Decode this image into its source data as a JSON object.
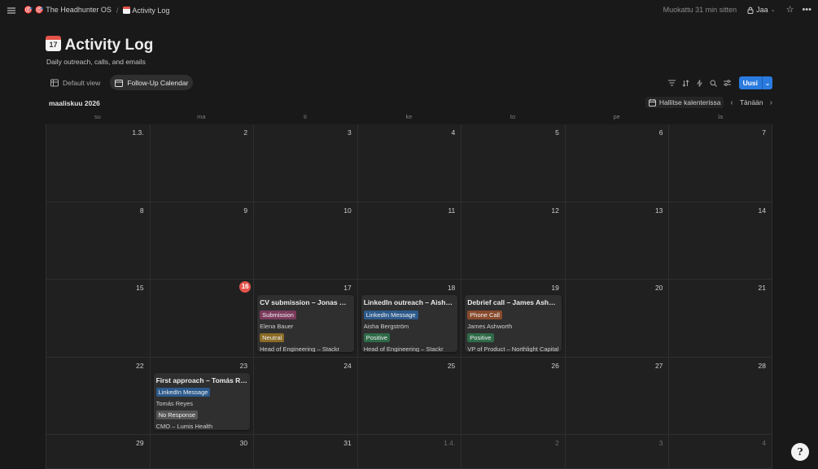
{
  "breadcrumb": {
    "workspace": "The Headhunter OS",
    "page": "Activity Log"
  },
  "header": {
    "edited": "Muokattu 31 min sitten",
    "share": "Jaa"
  },
  "page": {
    "title": "Activity Log",
    "subtitle": "Daily outreach, calls, and emails"
  },
  "views": [
    {
      "label": "Default view",
      "active": false
    },
    {
      "label": "Follow-Up Calendar",
      "active": true
    }
  ],
  "toolbar": {
    "new_label": "Uusi"
  },
  "calendar": {
    "month": "maaliskuu 2026",
    "manage_label": "Hallitse kalenterissa",
    "today_label": "Tänään",
    "weekdays": [
      "su",
      "ma",
      "ti",
      "ke",
      "to",
      "pe",
      "la"
    ],
    "days": [
      {
        "label": "1.3."
      },
      {
        "label": "2"
      },
      {
        "label": "3"
      },
      {
        "label": "4"
      },
      {
        "label": "5"
      },
      {
        "label": "6"
      },
      {
        "label": "7"
      },
      {
        "label": "8"
      },
      {
        "label": "9"
      },
      {
        "label": "10"
      },
      {
        "label": "11"
      },
      {
        "label": "12"
      },
      {
        "label": "13"
      },
      {
        "label": "14"
      },
      {
        "label": "15"
      },
      {
        "label": "16",
        "today": true
      },
      {
        "label": "17",
        "card": {
          "title": "CV submission – Jonas Weber",
          "type": "Submission",
          "type_color": "#7b3a5d",
          "person": "Elena Bauer",
          "outcome": "Neutral",
          "outcome_color": "#8a6a26",
          "role": "Head of Engineering – Stackr"
        }
      },
      {
        "label": "18",
        "card": {
          "title": "LinkedIn outreach – Aisha Bergström",
          "type": "LinkedIn Message",
          "type_color": "#2d5a8c",
          "person": "Aisha Bergström",
          "outcome": "Positive",
          "outcome_color": "#2f6a48",
          "role": "Head of Engineering – Stackr"
        }
      },
      {
        "label": "19",
        "card": {
          "title": "Debrief call – James Ashworth",
          "type": "Phone Call",
          "type_color": "#8a4a2c",
          "person": "James Ashworth",
          "outcome": "Positive",
          "outcome_color": "#2f6a48",
          "role": "VP of Product – Northlight Capital"
        }
      },
      {
        "label": "20"
      },
      {
        "label": "21"
      },
      {
        "label": "22"
      },
      {
        "label": "23",
        "card": {
          "title": "First approach – Tomás Reyes",
          "type": "LinkedIn Message",
          "type_color": "#2d5a8c",
          "person": "Tomás Reyes",
          "outcome": "No Response",
          "outcome_color": "#555555",
          "role": "CMO – Lumis Health"
        }
      },
      {
        "label": "24"
      },
      {
        "label": "25"
      },
      {
        "label": "26"
      },
      {
        "label": "27"
      },
      {
        "label": "28"
      },
      {
        "label": "29"
      },
      {
        "label": "30"
      },
      {
        "label": "31"
      },
      {
        "label": "1.4.",
        "outside": true
      },
      {
        "label": "2",
        "outside": true
      },
      {
        "label": "3",
        "outside": true
      },
      {
        "label": "4",
        "outside": true
      }
    ]
  }
}
